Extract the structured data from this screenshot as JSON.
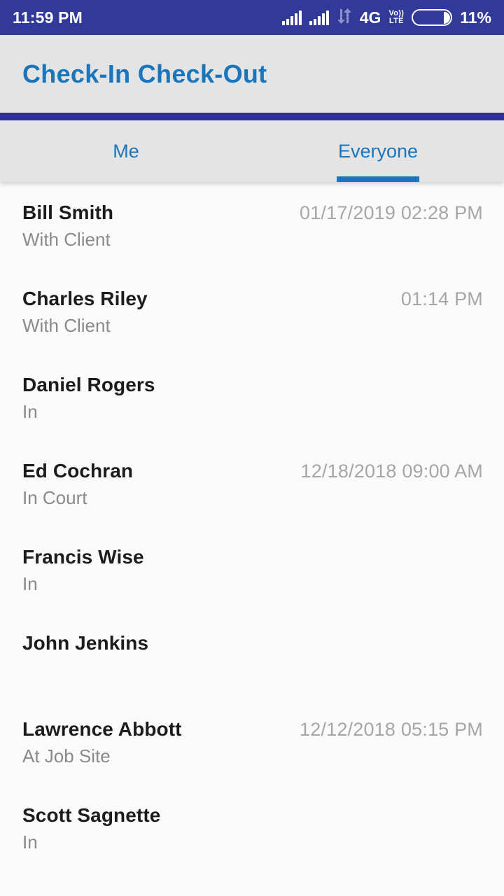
{
  "status_bar": {
    "clock": "11:59 PM",
    "network_type": "4G",
    "volte_top": "Vo))",
    "volte_bottom": "LTE",
    "battery_percent": "11%",
    "icons": [
      "signal-bars-icon",
      "signal-bars-icon",
      "data-transfer-icon",
      "volte-icon",
      "battery-icon"
    ],
    "background_color": "#313a99"
  },
  "app_bar": {
    "title": "Check-In Check-Out",
    "title_color": "#1a75bb",
    "background_color": "#e4e4e4",
    "rule_color": "#2e3192"
  },
  "tabs": {
    "items": [
      {
        "label": "Me",
        "active": false
      },
      {
        "label": "Everyone",
        "active": true
      }
    ],
    "active_color": "#1a75bb",
    "background_color": "#e4e4e4"
  },
  "people_list": {
    "rows": [
      {
        "name": "Bill Smith",
        "status": "With Client",
        "time": "01/17/2019 02:28 PM"
      },
      {
        "name": "Charles Riley",
        "status": "With Client",
        "time": "01:14 PM"
      },
      {
        "name": "Daniel Rogers",
        "status": "In",
        "time": ""
      },
      {
        "name": "Ed Cochran",
        "status": "In Court",
        "time": "12/18/2018 09:00 AM"
      },
      {
        "name": "Francis Wise",
        "status": "In",
        "time": ""
      },
      {
        "name": "John Jenkins",
        "status": "",
        "time": ""
      },
      {
        "name": "Lawrence Abbott",
        "status": "At Job Site",
        "time": "12/12/2018 05:15 PM"
      },
      {
        "name": "Scott Sagnette",
        "status": "In",
        "time": ""
      }
    ],
    "background_color": "#fafafa",
    "name_color": "#1c1c1c",
    "status_color": "#8a8a8a",
    "time_color": "#a6a6a6"
  }
}
